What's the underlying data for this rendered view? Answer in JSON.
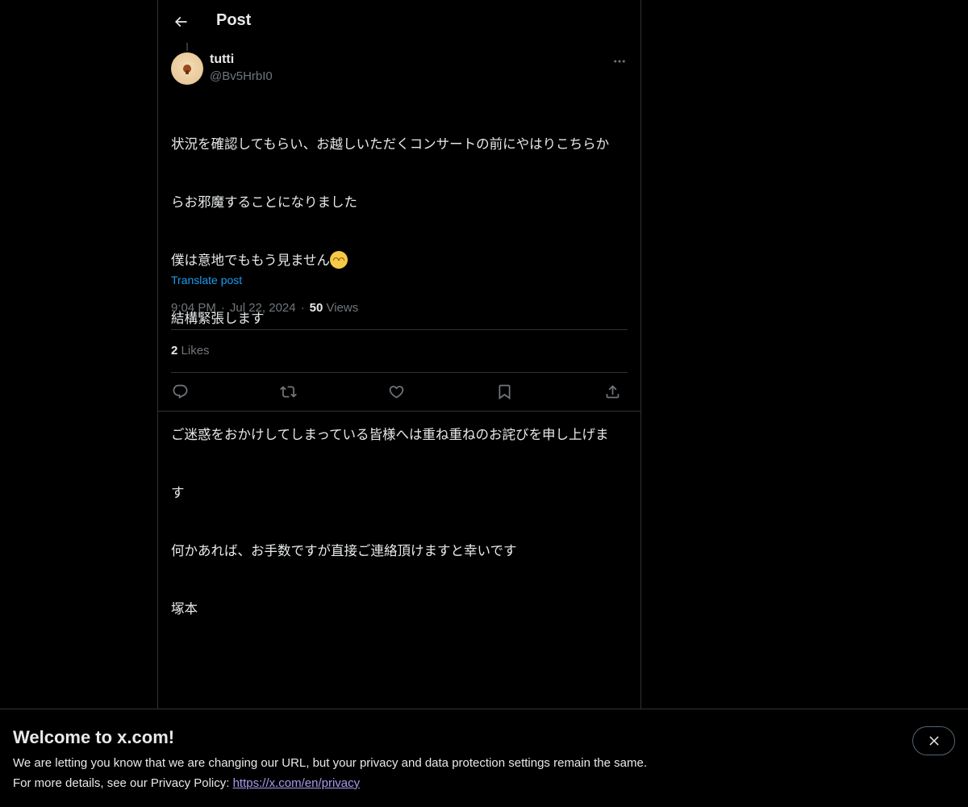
{
  "header": {
    "title": "Post"
  },
  "post": {
    "author": {
      "name": "tutti",
      "handle": "@Bv5HrbI0"
    },
    "text_lines": [
      "状況を確認してもらい、お越しいただくコンサートの前にやはりこちらか",
      "らお邪魔することになりました",
      "僕は意地でももう見ません",
      "結構緊張します",
      "",
      "ご迷惑をおかけしてしまっている皆様へは重ね重ねのお詫びを申し上げま",
      "す",
      "何かあれば、お手数ですが直接ご連絡頂けますと幸いです",
      "塚本"
    ],
    "translate_label": "Translate post",
    "time": "9:04 PM",
    "date": "Jul 22, 2024",
    "views_count": "50",
    "views_label": "Views",
    "likes_count": "2",
    "likes_label": "Likes"
  },
  "actions": [
    "reply-icon",
    "repost-icon",
    "like-icon",
    "bookmark-icon",
    "share-icon"
  ],
  "banner": {
    "title": "Welcome to x.com!",
    "line1": "We are letting you know that we are changing our URL, but your privacy and data protection settings remain the same.",
    "line2_prefix": "For more details, see our Privacy Policy: ",
    "link": "https://x.com/en/privacy"
  },
  "colors": {
    "background": "#000000",
    "text": "#e7e9ea",
    "muted": "#71767b",
    "link": "#1d9bf0",
    "border": "#2f3336",
    "banner_link": "#a99af0"
  }
}
